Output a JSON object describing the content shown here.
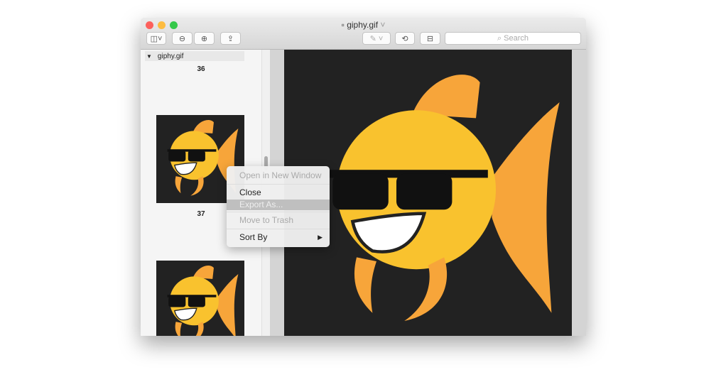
{
  "window": {
    "title": "giphy.gif",
    "search_placeholder": "Search"
  },
  "sidebar": {
    "file": "giphy.gif",
    "pages": [
      "36",
      "37"
    ]
  },
  "context_menu": {
    "items": [
      {
        "label": "Open in New Window",
        "enabled": false
      },
      {
        "label": "Close",
        "enabled": true
      },
      {
        "label": "Export As...",
        "enabled": false,
        "highlighted": true
      },
      {
        "label": "Move to Trash",
        "enabled": false
      },
      {
        "label": "Sort By",
        "enabled": true,
        "submenu": true
      }
    ]
  },
  "colors": {
    "fish": "#f9c22e",
    "fin": "#f7a53a",
    "background": "#222222"
  }
}
